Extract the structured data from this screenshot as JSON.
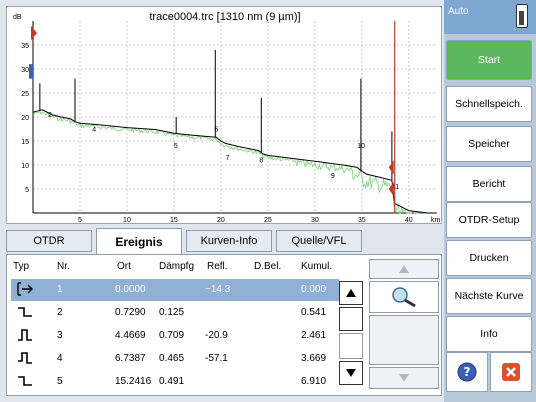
{
  "chart": {
    "title": "trace0004.trc [1310 nm (9 µm)]",
    "y_unit": "dB",
    "x_unit": "km",
    "y_ticks": [
      "35",
      "30",
      "25",
      "20",
      "15",
      "10",
      "5"
    ],
    "x_ticks": [
      "5",
      "10",
      "15",
      "20",
      "25",
      "30",
      "35",
      "40"
    ],
    "event_labels": [
      "2",
      "4",
      "5",
      "6",
      "7",
      "8",
      "9",
      "10",
      "11"
    ]
  },
  "chart_data": {
    "type": "line",
    "title": "trace0004.trc [1310 nm (9 µm)]",
    "xlabel": "km",
    "ylabel": "dB",
    "xlim": [
      0,
      43
    ],
    "ylim": [
      0,
      40
    ],
    "series": [
      {
        "x": [
          0,
          1,
          2,
          3,
          4,
          4.5,
          5,
          7,
          10,
          13,
          15,
          17,
          19.5,
          20,
          20.5,
          22,
          24,
          24.5,
          25,
          27,
          30,
          33,
          34.5,
          35,
          35.5,
          37,
          38.2,
          38.5,
          40,
          42
        ],
        "y": [
          21,
          21.5,
          20.5,
          20,
          19.6,
          19,
          18.7,
          18.4,
          17.8,
          17.4,
          16.6,
          16.2,
          15.8,
          15,
          14.5,
          13.8,
          13,
          12.3,
          12,
          11.5,
          10.8,
          10,
          9.5,
          8.7,
          8.1,
          7.4,
          6.8,
          2,
          0.5,
          0
        ]
      }
    ],
    "events_km": [
      0.73,
      4.47,
      6.74,
      15.24,
      19.4,
      22.1,
      24.3,
      33.0,
      34.9,
      38.2
    ]
  },
  "tabs": [
    "OTDR",
    "Ereignis",
    "Kurven-Info",
    "Quelle/VFL"
  ],
  "table": {
    "headers": [
      "Typ",
      "Nr.",
      "Ort",
      "Dämpfg",
      "Refl.",
      "D.Bel.",
      "Kumul."
    ],
    "rows": [
      {
        "nr": "1",
        "ort": "0.0000",
        "daempfg": "",
        "refl": "−14.3",
        "dbel": "",
        "kumul": "0.000"
      },
      {
        "nr": "2",
        "ort": "0.7290",
        "daempfg": "0.125",
        "refl": "",
        "dbel": "",
        "kumul": "0.541"
      },
      {
        "nr": "3",
        "ort": "4.4669",
        "daempfg": "0.709",
        "refl": "-20.9",
        "dbel": "",
        "kumul": "2.461"
      },
      {
        "nr": "4",
        "ort": "6.7387",
        "daempfg": "0.465",
        "refl": "-57.1",
        "dbel": "",
        "kumul": "3.669"
      },
      {
        "nr": "5",
        "ort": "15.2416",
        "daempfg": "0.491",
        "refl": "",
        "dbel": "",
        "kumul": "6.910"
      }
    ]
  },
  "sidebar": {
    "mode": "Auto",
    "buttons": [
      "Start",
      "Schnellspeich.",
      "Speicher",
      "Bericht",
      "OTDR-Setup",
      "Drucken",
      "Nächste Kurve",
      "Info"
    ]
  }
}
